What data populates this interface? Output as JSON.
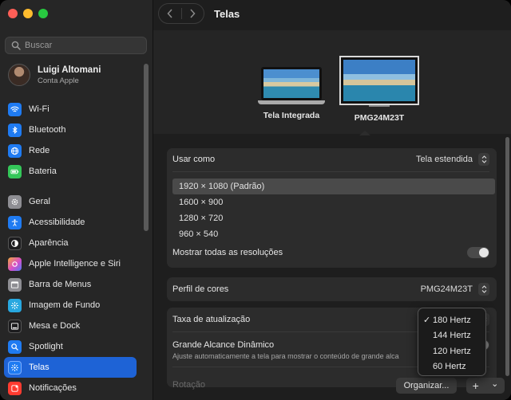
{
  "sidebar": {
    "search_placeholder": "Buscar",
    "user": {
      "name": "Luigi Altomani",
      "subtitle": "Conta Apple"
    },
    "items": [
      {
        "label": "Wi-Fi",
        "icon": "wifi-icon",
        "color": "#1f7bf2"
      },
      {
        "label": "Bluetooth",
        "icon": "bluetooth-icon",
        "color": "#1f7bf2"
      },
      {
        "label": "Rede",
        "icon": "globe-icon",
        "color": "#1f7bf2"
      },
      {
        "label": "Bateria",
        "icon": "battery-icon",
        "color": "#34c759"
      },
      {
        "label": "Geral",
        "icon": "gear-icon",
        "color": "#8e8e93"
      },
      {
        "label": "Acessibilidade",
        "icon": "accessibility-icon",
        "color": "#1f7bf2"
      },
      {
        "label": "Aparência",
        "icon": "appearance-icon",
        "color": "#1c1c1e"
      },
      {
        "label": "Apple Intelligence e Siri",
        "icon": "siri-icon",
        "color": "#d94ec9"
      },
      {
        "label": "Barra de Menus",
        "icon": "menubar-icon",
        "color": "#8e8e93"
      },
      {
        "label": "Imagem de Fundo",
        "icon": "wallpaper-icon",
        "color": "#28a8e0"
      },
      {
        "label": "Mesa e Dock",
        "icon": "dock-icon",
        "color": "#1c1c1e"
      },
      {
        "label": "Spotlight",
        "icon": "spotlight-icon",
        "color": "#1f7bf2"
      },
      {
        "label": "Telas",
        "icon": "display-icon",
        "color": "#1f7bf2",
        "active": true
      },
      {
        "label": "Notificações",
        "icon": "notifications-icon",
        "color": "#ff3b30"
      }
    ]
  },
  "header": {
    "title": "Telas"
  },
  "displays": [
    {
      "label": "Tela Integrada",
      "icon": "laptop-icon"
    },
    {
      "label": "PMG24M23T",
      "icon": "monitor-icon",
      "selected": true
    }
  ],
  "settings": {
    "use_as": {
      "label": "Usar como",
      "value": "Tela estendida"
    },
    "resolutions": [
      "1920 × 1080 (Padrão)",
      "1600 × 900",
      "1280 × 720",
      "960 × 540"
    ],
    "selected_resolution_index": 0,
    "show_all": {
      "label": "Mostrar todas as resoluções"
    },
    "color_profile": {
      "label": "Perfil de cores",
      "value": "PMG24M23T"
    },
    "refresh_rate": {
      "label": "Taxa de atualização"
    },
    "hdr": {
      "label": "Grande Alcance Dinâmico",
      "description": "Ajuste automaticamente a tela para mostrar o conteúdo de grande alca"
    },
    "rotation": {
      "label": "Rotação"
    }
  },
  "refresh_menu": {
    "options": [
      "180 Hertz",
      "144 Hertz",
      "120 Hertz",
      "60 Hertz"
    ],
    "checkmark": "✓"
  },
  "footer": {
    "arrange_label": "Organizar...",
    "add_label": "+",
    "more_label": "⌄"
  },
  "colors": {
    "accent": "#1e63d6"
  }
}
